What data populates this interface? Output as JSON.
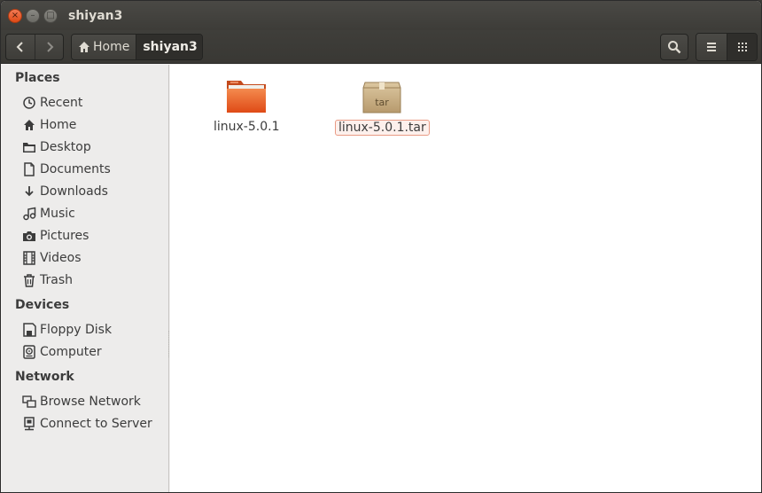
{
  "window": {
    "title": "shiyan3"
  },
  "titlebar": {
    "close_glyph": "×",
    "min_glyph": "–",
    "max_glyph": "□"
  },
  "toolbar": {
    "breadcrumbs": [
      "Home",
      "shiyan3"
    ]
  },
  "sidebar": {
    "sections": [
      {
        "title": "Places",
        "items": [
          {
            "label": "Recent",
            "icon": "clock-icon"
          },
          {
            "label": "Home",
            "icon": "home-icon"
          },
          {
            "label": "Desktop",
            "icon": "folder-icon"
          },
          {
            "label": "Documents",
            "icon": "document-icon"
          },
          {
            "label": "Downloads",
            "icon": "download-icon"
          },
          {
            "label": "Music",
            "icon": "music-icon"
          },
          {
            "label": "Pictures",
            "icon": "camera-icon"
          },
          {
            "label": "Videos",
            "icon": "film-icon"
          },
          {
            "label": "Trash",
            "icon": "trash-icon"
          }
        ]
      },
      {
        "title": "Devices",
        "items": [
          {
            "label": "Floppy Disk",
            "icon": "floppy-icon"
          },
          {
            "label": "Computer",
            "icon": "harddisk-icon"
          }
        ]
      },
      {
        "title": "Network",
        "items": [
          {
            "label": "Browse Network",
            "icon": "network-icon"
          },
          {
            "label": "Connect to Server",
            "icon": "server-icon"
          }
        ]
      }
    ]
  },
  "content": {
    "files": [
      {
        "name": "linux-5.0.1",
        "type": "folder",
        "selected": false
      },
      {
        "name": "linux-5.0.1.tar",
        "type": "archive",
        "badge": "tar",
        "selected": true
      }
    ]
  },
  "colors": {
    "accent": "#e95420",
    "titlebar": "#3c3b37",
    "selection": "#e99b85"
  }
}
